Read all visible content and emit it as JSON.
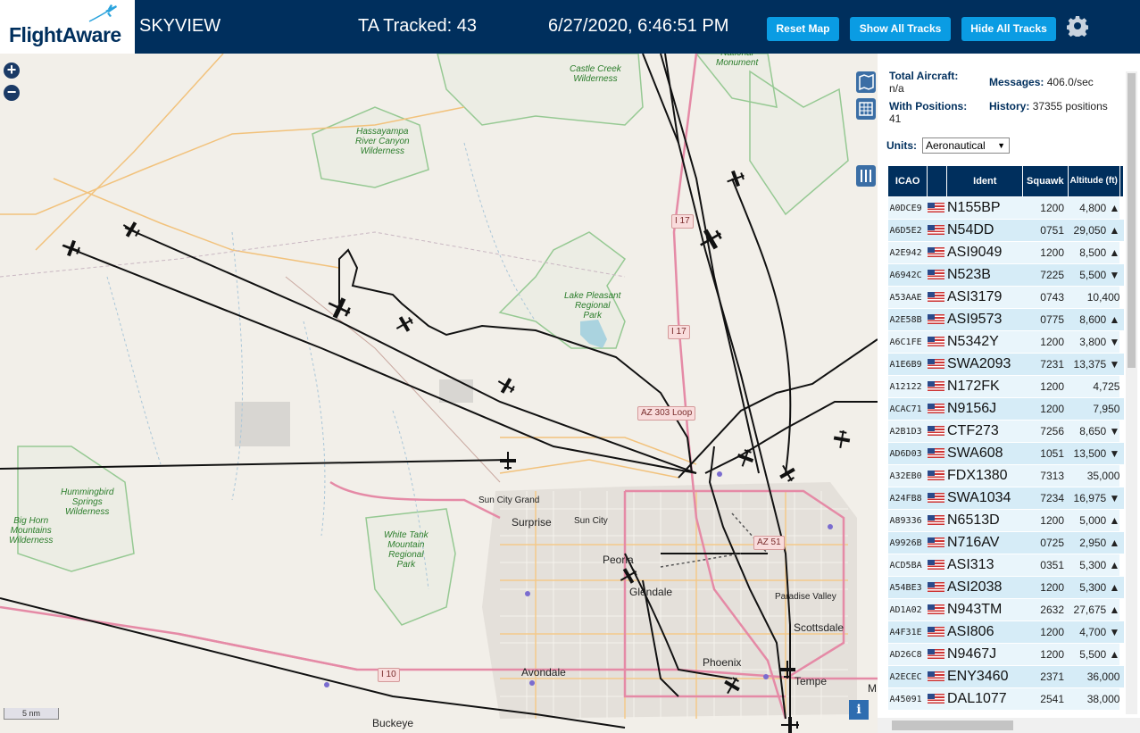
{
  "header": {
    "logo_text": "FlightAware",
    "app_name": "SKYVIEW",
    "tracked_label": "TA Tracked: 43",
    "datetime": "6/27/2020, 6:46:51 PM",
    "buttons": {
      "reset": "Reset Map",
      "show_all": "Show All Tracks",
      "hide_all": "Hide All Tracks"
    },
    "settings_icon": "gear-icon"
  },
  "map": {
    "scale_label": "5 nm",
    "info_label": "i",
    "labels": {
      "surprise": "Surprise",
      "sun_city": "Sun City",
      "sun_city_grand": "Sun City Grand",
      "peoria": "Peoria",
      "glendale": "Glendale",
      "phoenix": "Phoenix",
      "tempe": "Tempe",
      "scottsdale": "Scottsdale",
      "paradise_valley": "Paradise Valley",
      "avondale": "Avondale",
      "buckeye": "Buckeye",
      "m_edge": "M",
      "castle_creek": "Castle Creek\nWilderness",
      "hassayampa": "Hassayampa\nRiver Canyon\nWilderness",
      "lake_pleasant": "Lake Pleasant\nRegional\nPark",
      "national_monument": "National\nMonument",
      "hummingbird": "Hummingbird\nSprings\nWilderness",
      "big_horn": "Big Horn\nMountains\nWilderness",
      "white_tank": "White Tank\nMountain\nRegional\nPark"
    },
    "shields": {
      "i17_north": "I 17",
      "i17": "I 17",
      "az303": "AZ 303 Loop",
      "az51": "AZ 51",
      "i10": "I 10"
    }
  },
  "panel": {
    "stats": {
      "total_aircraft_label": "Total Aircraft:",
      "total_aircraft_value": "n/a",
      "with_positions_label": "With Positions:",
      "with_positions_value": "41",
      "messages_label": "Messages:",
      "messages_value": "406.0/sec",
      "history_label": "History:",
      "history_value": "37355 positions"
    },
    "units_label": "Units:",
    "units_value": "Aeronautical",
    "columns": [
      "ICAO",
      "",
      "Ident",
      "Squawk",
      "Altitude (ft)"
    ],
    "rows": [
      {
        "icao": "A0DCE9",
        "ident": "N155BP",
        "squawk": "1200",
        "alt": "4,800 ▲"
      },
      {
        "icao": "A6D5E2",
        "ident": "N54DD",
        "squawk": "0751",
        "alt": "29,050 ▲"
      },
      {
        "icao": "A2E942",
        "ident": "ASI9049",
        "squawk": "1200",
        "alt": "8,500 ▲"
      },
      {
        "icao": "A6942C",
        "ident": "N523B",
        "squawk": "7225",
        "alt": "5,500 ▼"
      },
      {
        "icao": "A53AAE",
        "ident": "ASI3179",
        "squawk": "0743",
        "alt": "10,400"
      },
      {
        "icao": "A2E58B",
        "ident": "ASI9573",
        "squawk": "0775",
        "alt": "8,600 ▲"
      },
      {
        "icao": "A6C1FE",
        "ident": "N5342Y",
        "squawk": "1200",
        "alt": "3,800 ▼"
      },
      {
        "icao": "A1E6B9",
        "ident": "SWA2093",
        "squawk": "7231",
        "alt": "13,375 ▼"
      },
      {
        "icao": "A12122",
        "ident": "N172FK",
        "squawk": "1200",
        "alt": "4,725"
      },
      {
        "icao": "ACAC71",
        "ident": "N9156J",
        "squawk": "1200",
        "alt": "7,950"
      },
      {
        "icao": "A2B1D3",
        "ident": "CTF273",
        "squawk": "7256",
        "alt": "8,650 ▼"
      },
      {
        "icao": "AD6D03",
        "ident": "SWA608",
        "squawk": "1051",
        "alt": "13,500 ▼"
      },
      {
        "icao": "A32EB0",
        "ident": "FDX1380",
        "squawk": "7313",
        "alt": "35,000"
      },
      {
        "icao": "A24FB8",
        "ident": "SWA1034",
        "squawk": "7234",
        "alt": "16,975 ▼"
      },
      {
        "icao": "A89336",
        "ident": "N6513D",
        "squawk": "1200",
        "alt": "5,000 ▲"
      },
      {
        "icao": "A9926B",
        "ident": "N716AV",
        "squawk": "0725",
        "alt": "2,950 ▲"
      },
      {
        "icao": "ACD5BA",
        "ident": "ASI313",
        "squawk": "0351",
        "alt": "5,300 ▲"
      },
      {
        "icao": "A54BE3",
        "ident": "ASI2038",
        "squawk": "1200",
        "alt": "5,300 ▲"
      },
      {
        "icao": "AD1A02",
        "ident": "N943TM",
        "squawk": "2632",
        "alt": "27,675 ▲"
      },
      {
        "icao": "A4F31E",
        "ident": "ASI806",
        "squawk": "1200",
        "alt": "4,700 ▼"
      },
      {
        "icao": "AD26C8",
        "ident": "N9467J",
        "squawk": "1200",
        "alt": "5,500 ▲"
      },
      {
        "icao": "A2ECEC",
        "ident": "ENY3460",
        "squawk": "2371",
        "alt": "36,000"
      },
      {
        "icao": "A45091",
        "ident": "DAL1077",
        "squawk": "2541",
        "alt": "38,000"
      }
    ]
  },
  "colors": {
    "header_bg": "#002f5d",
    "button": "#0a9ce3",
    "row_a": "#e9f5fb",
    "row_b": "#d6ecf7",
    "track": "#111111"
  }
}
